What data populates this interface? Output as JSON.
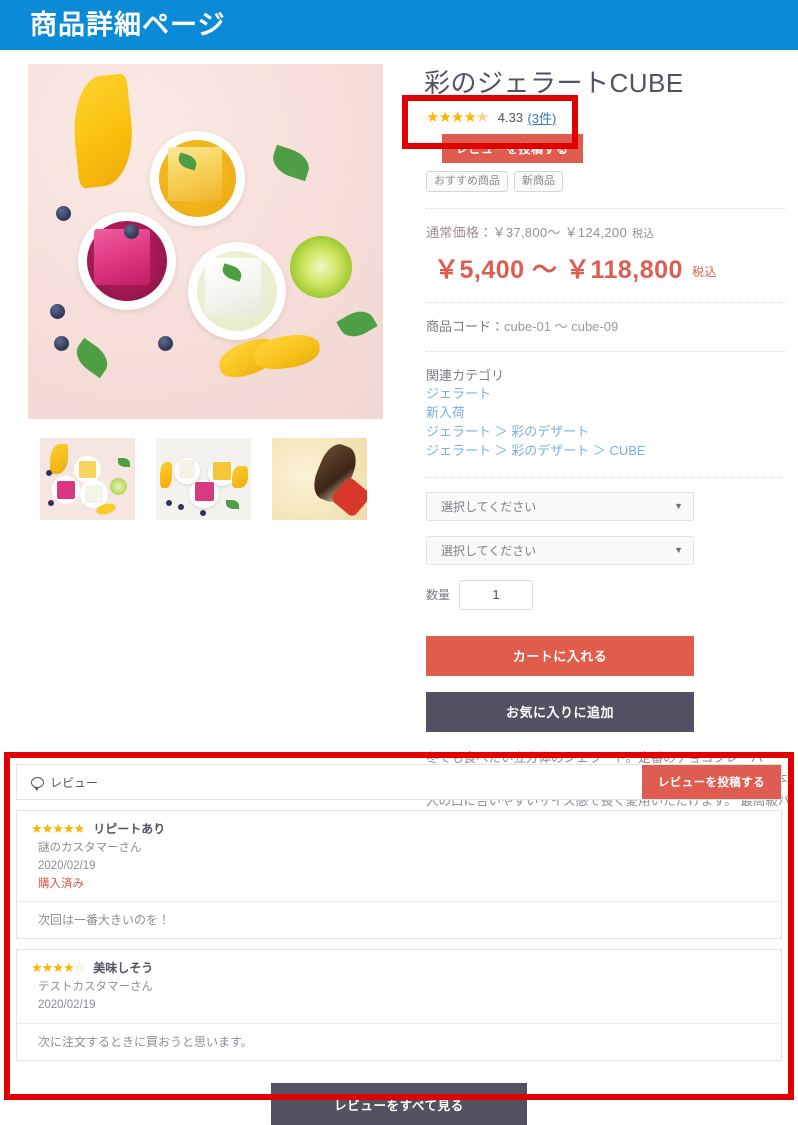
{
  "header": {
    "title": "商品詳細ページ",
    "bar_color": "#0b8ad8"
  },
  "product": {
    "name": "彩のジェラートCUBE",
    "rating": {
      "stars_filled": 4,
      "stars_half": 1,
      "stars_total": 5,
      "value": "4.33",
      "count_label": "(3件)"
    },
    "post_review_button": "レビューを投稿する",
    "tags": [
      "おすすめ商品",
      "新商品"
    ],
    "normal_price_label": "通常価格：",
    "normal_price": "￥37,800〜 ￥124,200",
    "normal_price_tax": "税込",
    "sale_price": "￥5,400 〜 ￥118,800",
    "sale_price_tax": "税込",
    "product_code_label": "商品コード：",
    "product_code": "cube-01 〜 cube-09",
    "category_heading": "関連カテゴリ",
    "categories": [
      "ジェラート",
      "新入荷",
      "ジェラート ＞ 彩のデザート",
      "ジェラート ＞ 彩のデザート ＞ CUBE"
    ],
    "selects": [
      {
        "value": "選択してください"
      },
      {
        "value": "選択してください"
      }
    ],
    "quantity_label": "数量",
    "quantity_value": "1",
    "add_to_cart_button": "カートに入れる",
    "add_to_favorite_button": "お気に入りに追加",
    "description": "冬でも食べたい立方体のジェラート。定番のチョコフレーバーは、チョコレート特有の甘い香りが特徴です。適度な甘みと日本人の口に合いやすいサイズ感で長く愛用いただけます。\n最高級バニラフレーバーは、贈り物としても人気です。",
    "main_image_alt": "彩のジェラートCUBE メイン画像",
    "thumbnails": [
      {
        "alt": "ジェラートキューブ 3種盛り"
      },
      {
        "alt": "ジェラートキューブ 白背景"
      },
      {
        "alt": "バニラクリームとスクープ"
      }
    ]
  },
  "reviews": {
    "section_title": "レビュー",
    "post_button": "レビューを投稿する",
    "view_all_button": "レビューをすべて見る",
    "items": [
      {
        "stars_filled": 5,
        "stars_total": 5,
        "title": "リピートあり",
        "author": "謎のカスタマーさん",
        "date": "2020/02/19",
        "purchased_label": "購入済み",
        "body": "次回は一番大きいのを！"
      },
      {
        "stars_filled": 4,
        "stars_total": 5,
        "title": "美味しそう",
        "author": "テストカスタマーさん",
        "date": "2020/02/19",
        "purchased_label": "",
        "body": "次に注文するときに買おうと思います。"
      }
    ]
  },
  "annotations": {
    "color": "#e00000",
    "boxes": [
      "rating-area-highlight",
      "review-section-highlight"
    ]
  },
  "colors": {
    "accent_blue": "#0b8ad8",
    "accent_red": "#de5d50",
    "dark_button": "#525263",
    "star_gold": "#fbb600",
    "link_blue": "#7ab0e0",
    "annotation_red": "#e00000"
  }
}
